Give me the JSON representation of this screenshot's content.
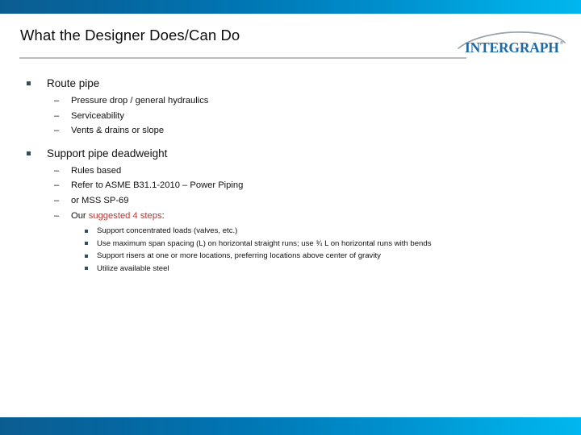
{
  "slide": {
    "title": "What the Designer Does/Can Do",
    "logo": {
      "name": "intergraph-logo",
      "wordmark": "INTERGRAPH",
      "trademark": "®"
    },
    "colors": {
      "band_left": "#0b5d91",
      "band_right": "#00b6ee",
      "bullet_square": "#2d4f5e",
      "accent_red": "#b03a36",
      "rule_gray": "#bcbcbc",
      "text": "#111111"
    },
    "sections": [
      {
        "heading": "Route pipe",
        "items": [
          {
            "dash": "–",
            "text": "Pressure drop / general hydraulics"
          },
          {
            "dash": "–",
            "text": "Serviceability"
          },
          {
            "dash": "–",
            "text": "Vents & drains or slope"
          }
        ],
        "subitems": []
      },
      {
        "heading": "Support pipe deadweight",
        "items": [
          {
            "dash": "–",
            "text": "Rules based"
          },
          {
            "dash": "–",
            "text": "Refer to ASME B31.1-2010 – Power Piping"
          },
          {
            "dash": "–",
            "text": "or MSS SP-69"
          }
        ],
        "highlight_item": {
          "dash": "–",
          "prefix": "Our ",
          "accent": "suggested 4 steps",
          "suffix": ":"
        },
        "subitems": [
          "Support concentrated loads (valves, etc.)",
          "Use maximum span spacing (L) on horizontal straight runs; use ¾ L on horizontal runs with bends",
          "Support risers at one or more locations, preferring locations above center of gravity",
          "Utilize available steel"
        ]
      }
    ]
  }
}
